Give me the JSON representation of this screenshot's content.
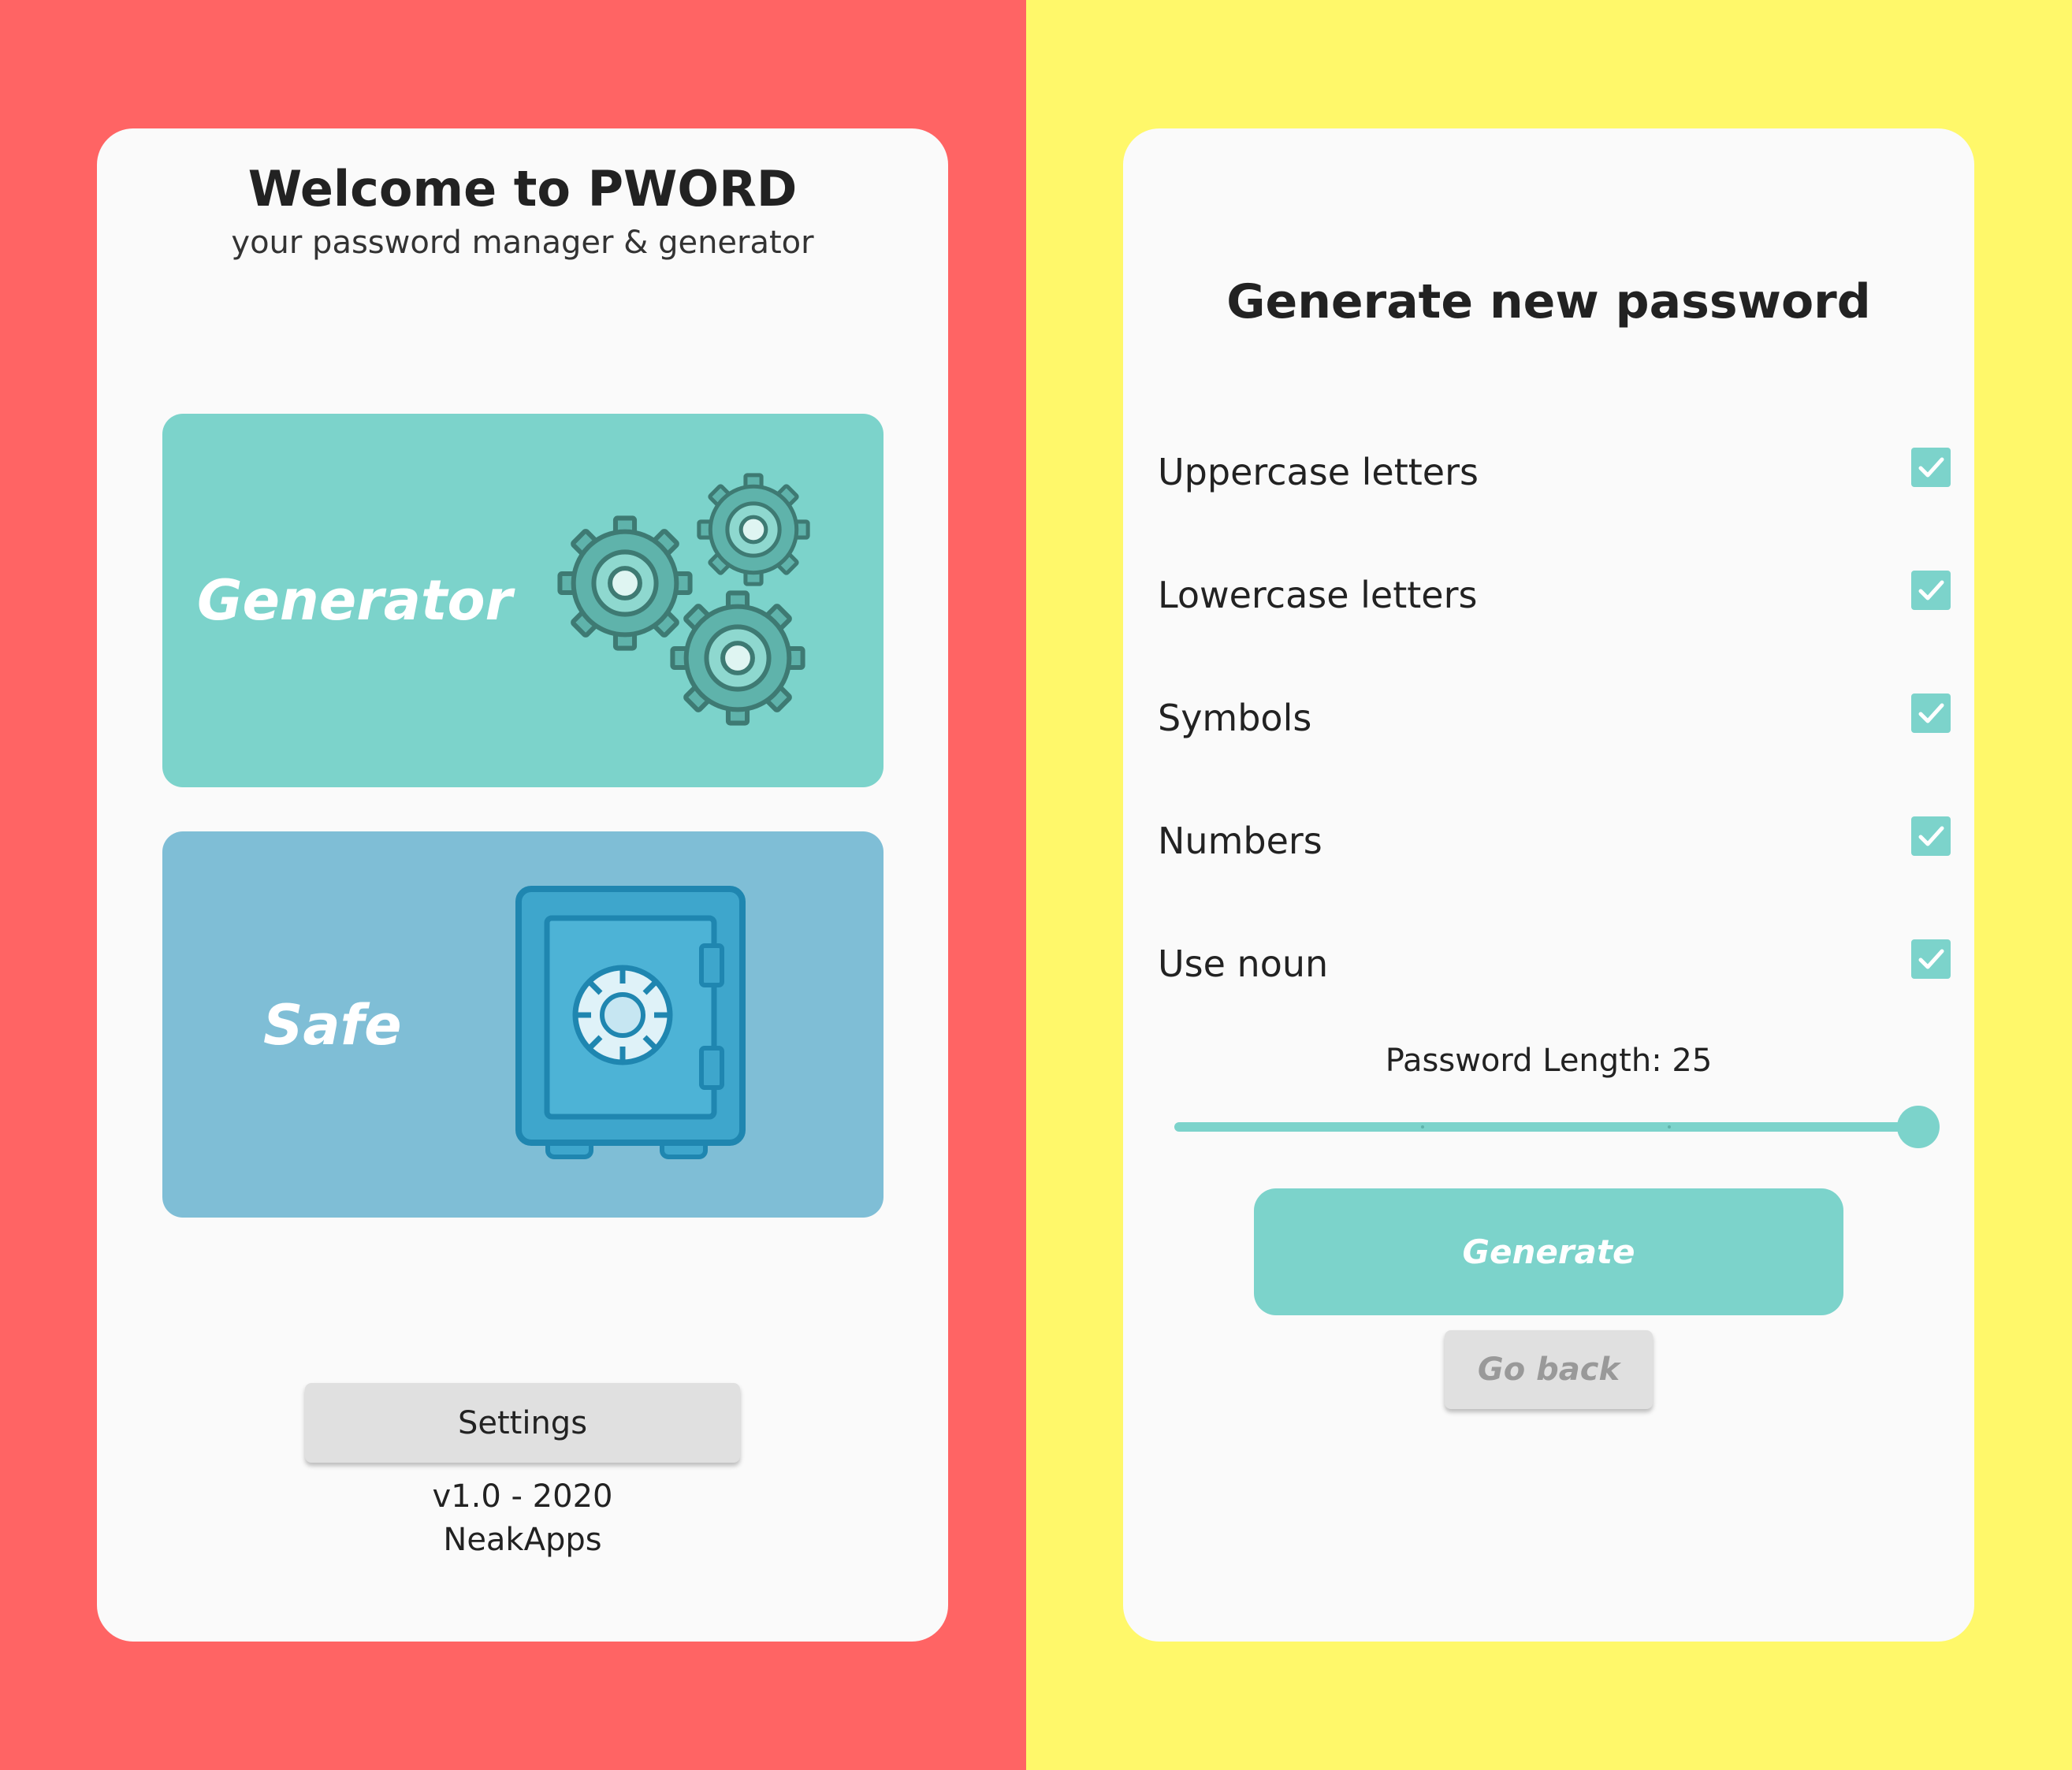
{
  "colors": {
    "left_background": "#ff6464",
    "right_background": "#fff86a",
    "generator_card": "#7cd3cb",
    "safe_card": "#7fbed6",
    "accent": "#7cd3cb"
  },
  "home": {
    "title": "Welcome to PWORD",
    "subtitle": "your password manager & generator",
    "generator_card": {
      "label": "Generator",
      "icon": "gears-icon"
    },
    "safe_card": {
      "label": "Safe",
      "icon": "safe-icon"
    },
    "settings_label": "Settings",
    "version": "v1.0 - 2020",
    "company": "NeakApps"
  },
  "generator": {
    "title": "Generate new password",
    "options": [
      {
        "label": "Uppercase letters",
        "checked": true
      },
      {
        "label": "Lowercase letters",
        "checked": true
      },
      {
        "label": "Symbols",
        "checked": true
      },
      {
        "label": "Numbers",
        "checked": true
      },
      {
        "label": "Use noun",
        "checked": true
      }
    ],
    "length_label": "Password Length: 25",
    "length_value": 25,
    "slider_fill_fraction": 1.0,
    "generate_label": "Generate",
    "go_back_label": "Go back"
  }
}
